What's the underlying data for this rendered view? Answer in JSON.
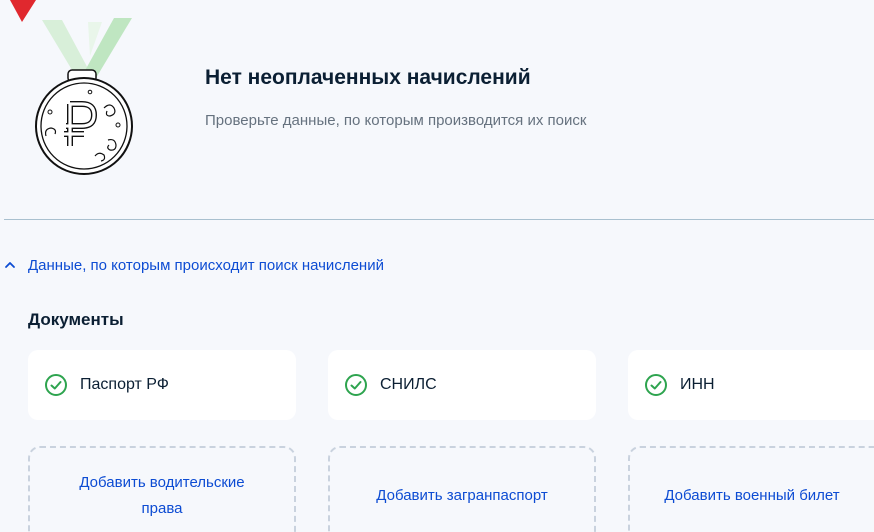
{
  "status": {
    "title": "Нет неоплаченных начислений",
    "subtitle": "Проверьте данные, по которым производится их поиск"
  },
  "search_data_toggle": {
    "label": "Данные, по которым происходит поиск начислений",
    "icon": "chevron-up-icon"
  },
  "documents": {
    "heading": "Документы",
    "added": [
      {
        "label": "Паспорт РФ",
        "icon": "check-circle-icon"
      },
      {
        "label": "СНИЛС",
        "icon": "check-circle-icon"
      },
      {
        "label": "ИНН",
        "icon": "check-circle-icon"
      }
    ],
    "add_actions": [
      {
        "label": "Добавить водительские права"
      },
      {
        "label": "Добавить загранпаспорт"
      },
      {
        "label": "Добавить военный билет"
      }
    ]
  },
  "colors": {
    "accent": "#0d4cd3",
    "success": "#2ea44f",
    "text": "#0b1f33",
    "muted": "#66727f",
    "background": "#f6f8fc"
  }
}
